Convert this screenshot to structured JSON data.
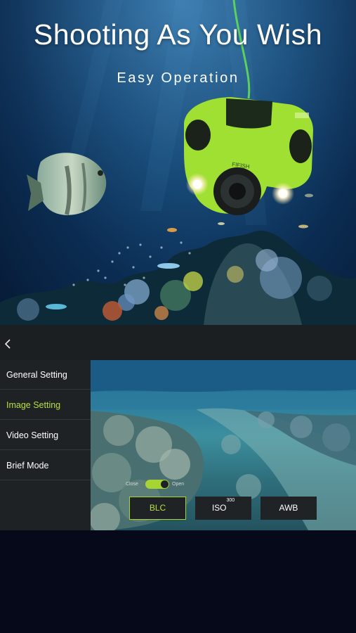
{
  "hero": {
    "title": "Shooting As You Wish",
    "subtitle": "Easy Operation",
    "drone_brand": "FIFISH"
  },
  "panel": {
    "back_icon": "chevron-left-icon",
    "menu": [
      {
        "label": "General Setting",
        "active": false
      },
      {
        "label": "Image Setting",
        "active": true
      },
      {
        "label": "Video Setting",
        "active": false
      },
      {
        "label": "Brief Mode",
        "active": false
      }
    ],
    "toggle": {
      "off_label": "Close",
      "on_label": "Open",
      "state": "Open"
    },
    "buttons": {
      "blc": "BLC",
      "iso_label": "ISO",
      "iso_value": "300",
      "awb": "AWB"
    }
  },
  "colors": {
    "accent": "#b8e13a",
    "drone_body": "#9fe032",
    "panel_bg": "#1e2124",
    "button_bg": "#1f2326"
  }
}
